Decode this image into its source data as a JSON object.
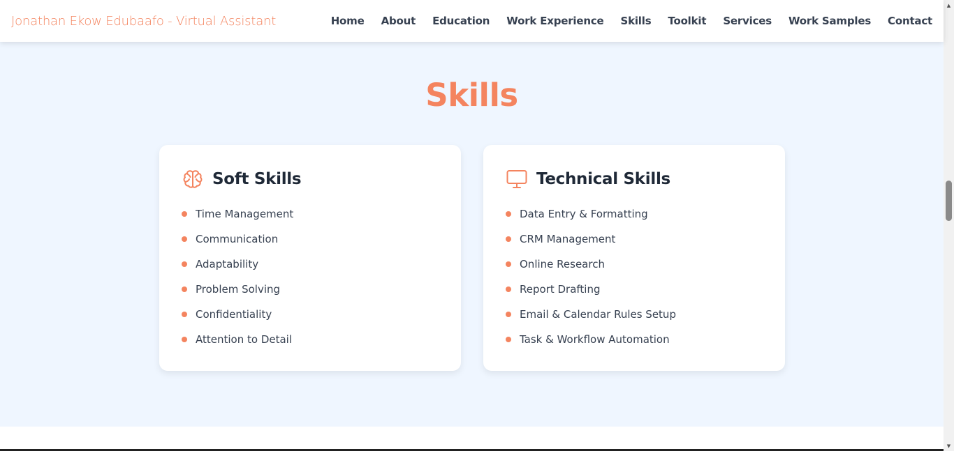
{
  "nav": {
    "brand": "Jonathan Ekow Edubaafo - Virtual Assistant",
    "links": [
      "Home",
      "About",
      "Education",
      "Work Experience",
      "Skills",
      "Toolkit",
      "Services",
      "Work Samples",
      "Contact"
    ]
  },
  "skills_section": {
    "title": "Skills",
    "soft": {
      "icon": "brain-icon",
      "title": "Soft Skills",
      "items": [
        "Time Management",
        "Communication",
        "Adaptability",
        "Problem Solving",
        "Confidentiality",
        "Attention to Detail"
      ]
    },
    "technical": {
      "icon": "monitor-icon",
      "title": "Technical Skills",
      "items": [
        "Data Entry & Formatting",
        "CRM Management",
        "Online Research",
        "Report Drafting",
        "Email & Calendar Rules Setup",
        "Task & Workflow Automation"
      ]
    }
  },
  "colors": {
    "accent": "#f4845f",
    "section_bg": "#eff6ff",
    "text": "#1f2937"
  }
}
